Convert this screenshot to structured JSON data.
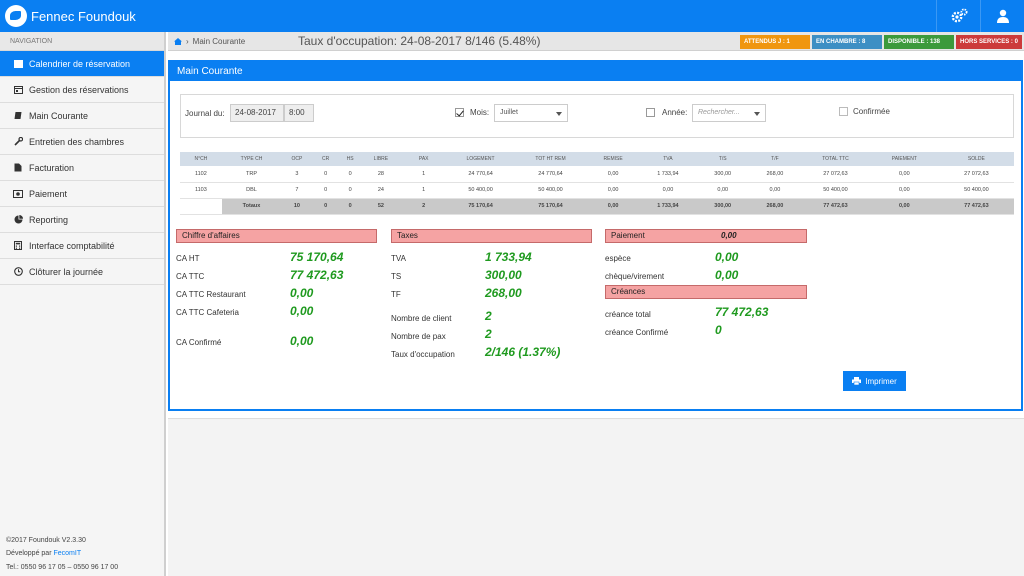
{
  "app": {
    "title": "Fennec Foundouk"
  },
  "sidebar": {
    "header": "NAVIGATION",
    "items": [
      {
        "label": "Calendrier de réservation",
        "icon": "calendar-icon"
      },
      {
        "label": "Gestion des réservations",
        "icon": "calendar-check-icon"
      },
      {
        "label": "Main Courante",
        "icon": "book-icon"
      },
      {
        "label": "Entretien des chambres",
        "icon": "wrench-icon"
      },
      {
        "label": "Facturation",
        "icon": "file-icon"
      },
      {
        "label": "Paiement",
        "icon": "money-icon"
      },
      {
        "label": "Reporting",
        "icon": "pie-chart-icon"
      },
      {
        "label": "Interface comptabilité",
        "icon": "calculator-icon"
      },
      {
        "label": "Clôturer la journée",
        "icon": "clock-icon"
      }
    ],
    "footer": {
      "version": "©2017 Foundouk V2.3.30",
      "dev_prefix": "Développé par ",
      "dev_link": "FecomIT",
      "phone": "Tel.: 0550 96 17 05 – 0550 96 17 00"
    }
  },
  "breadcrumb": {
    "current": "Main Courante"
  },
  "occupancy_title": "Taux d'occupation: 24-08-2017  8/146 (5.48%)",
  "badges": [
    {
      "label": "ATTENDUS J : 1",
      "color": "#f0960f"
    },
    {
      "label": "EN CHAMBRE : 8",
      "color": "#3d8fc4"
    },
    {
      "label": "DISPONIBLE : 138",
      "color": "#3c9a3c"
    },
    {
      "label": "HORS SERVICES : 0",
      "color": "#cc3b3b"
    }
  ],
  "panel": {
    "title": "Main Courante"
  },
  "filters": {
    "journal_label": "Journal du:",
    "journal_date": "24-08-2017",
    "journal_time": "8:00",
    "mois_label": "Mois:",
    "mois_value": "Juillet",
    "mois_checked": true,
    "annee_label": "Année:",
    "annee_placeholder": "Rechercher...",
    "annee_checked": false,
    "confirmee_label": "Confirmée",
    "confirmee_checked": false
  },
  "table": {
    "headers": [
      "N°CH",
      "TYPE CH",
      "OCP",
      "CR",
      "HS",
      "LIBRE",
      "PAX",
      "LOGEMENT",
      "TOT HT REM",
      "REMISE",
      "TVA",
      "T/S",
      "T/F",
      "TOTAL TTC",
      "PAIEMENT",
      "SOLDE"
    ],
    "rows": [
      [
        "1102",
        "TRP",
        "3",
        "0",
        "0",
        "28",
        "1",
        "24 770,64",
        "24 770,64",
        "0,00",
        "1 733,94",
        "300,00",
        "268,00",
        "27 072,63",
        "0,00",
        "27 072,63"
      ],
      [
        "1103",
        "DBL",
        "7",
        "0",
        "0",
        "24",
        "1",
        "50 400,00",
        "50 400,00",
        "0,00",
        "0,00",
        "0,00",
        "0,00",
        "50 400,00",
        "0,00",
        "50 400,00"
      ]
    ],
    "total": [
      "",
      "Totaux",
      "10",
      "0",
      "0",
      "52",
      "2",
      "75 170,64",
      "75 170,64",
      "0,00",
      "1 733,94",
      "300,00",
      "268,00",
      "77 472,63",
      "0,00",
      "77 472,63"
    ]
  },
  "chiffre": {
    "title": "Chiffre d'affaires",
    "rows": [
      {
        "label": "CA HT",
        "value": "75 170,64"
      },
      {
        "label": "CA TTC",
        "value": "77 472,63"
      },
      {
        "label": "CA TTC Restaurant",
        "value": "0,00"
      },
      {
        "label": "CA TTC Cafeteria",
        "value": "0,00"
      },
      {
        "label": "CA Confirmé",
        "value": "0,00"
      }
    ]
  },
  "taxes": {
    "title": "Taxes",
    "rows": [
      {
        "label": "TVA",
        "value": "1 733,94"
      },
      {
        "label": "TS",
        "value": "300,00"
      },
      {
        "label": "TF",
        "value": "268,00"
      },
      {
        "label": "Nombre de client",
        "value": "2"
      },
      {
        "label": "Nombre de pax",
        "value": "2"
      },
      {
        "label": "Taux d'occupation",
        "value": "2/146 (1.37%)"
      }
    ]
  },
  "paiement": {
    "title": "Paiement",
    "title_value": "0,00",
    "rows": [
      {
        "label": "espèce",
        "value": "0,00"
      },
      {
        "label": "chèque/virement",
        "value": "0,00"
      }
    ]
  },
  "creances": {
    "title": "Créances",
    "rows": [
      {
        "label": "créance total",
        "value": "77 472,63"
      },
      {
        "label": "créance Confirmé",
        "value": "0"
      }
    ]
  },
  "print_label": "Imprimer"
}
